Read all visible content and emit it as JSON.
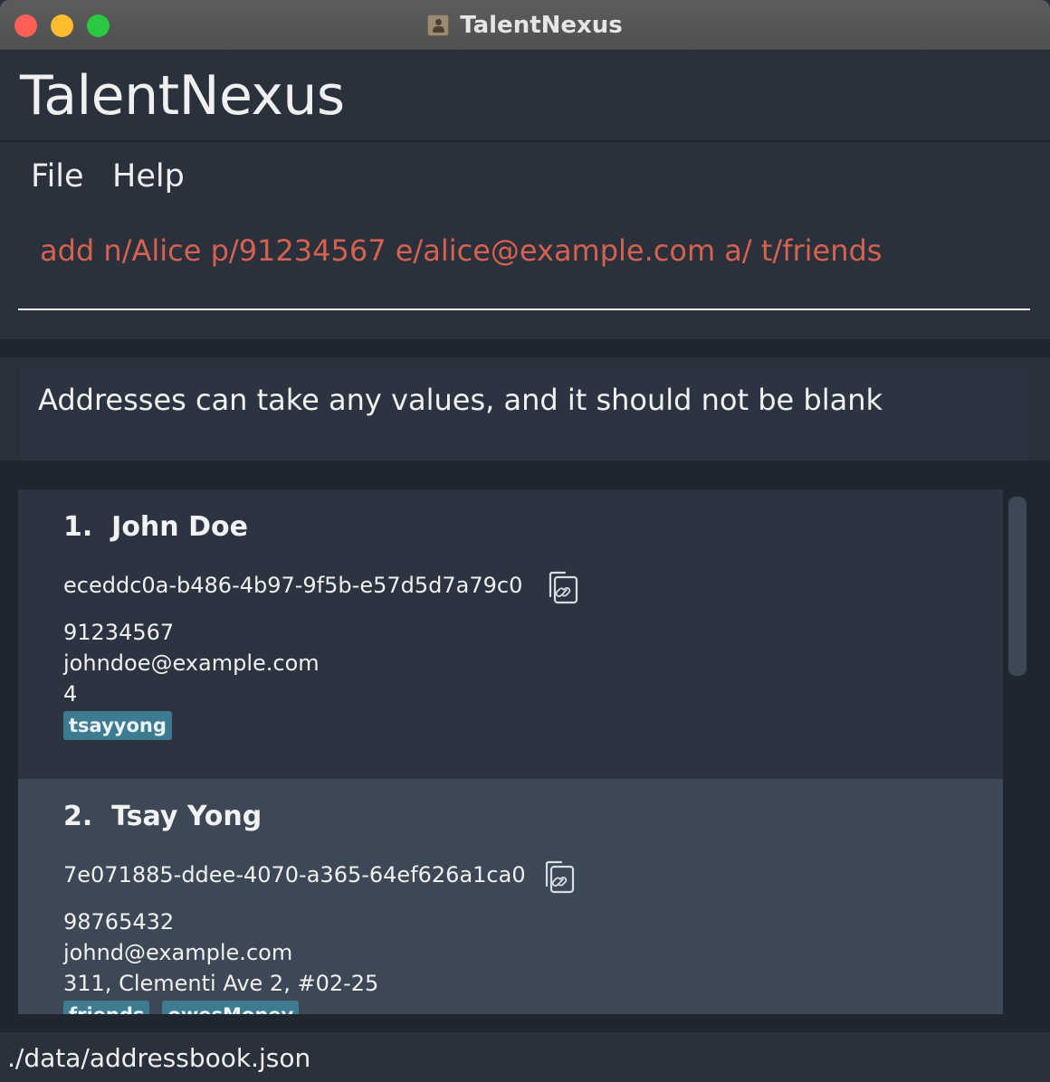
{
  "window": {
    "title": "TalentNexus"
  },
  "header": {
    "app_name": "TalentNexus"
  },
  "menu": {
    "items": [
      {
        "label": "File"
      },
      {
        "label": "Help"
      }
    ]
  },
  "command": {
    "value": "add n/Alice p/91234567 e/alice@example.com a/ t/friends"
  },
  "result": {
    "message": "Addresses can take any values, and it should not be blank"
  },
  "persons": [
    {
      "index_name": "1.  John Doe",
      "uuid": "eceddc0a-b486-4b97-9f5b-e57d5d7a79c0",
      "phone": "91234567",
      "email": "johndoe@example.com",
      "address": "4",
      "tags": [
        "tsayyong"
      ]
    },
    {
      "index_name": "2.  Tsay Yong",
      "uuid": "7e071885-ddee-4070-a365-64ef626a1ca0",
      "phone": "98765432",
      "email": "johnd@example.com",
      "address": "311, Clementi Ave 2, #02-25",
      "tags": [
        "friends",
        "owesMoney"
      ]
    }
  ],
  "status": {
    "file_path": "./data/addressbook.json"
  },
  "icons": {
    "copy": "copy-link-icon",
    "app": "contacts-icon"
  },
  "colors": {
    "command_text": "#d5624f",
    "tag_bg": "#3e7b91",
    "card_bg": "#2c3441",
    "card_selected_bg": "#3d4856"
  }
}
